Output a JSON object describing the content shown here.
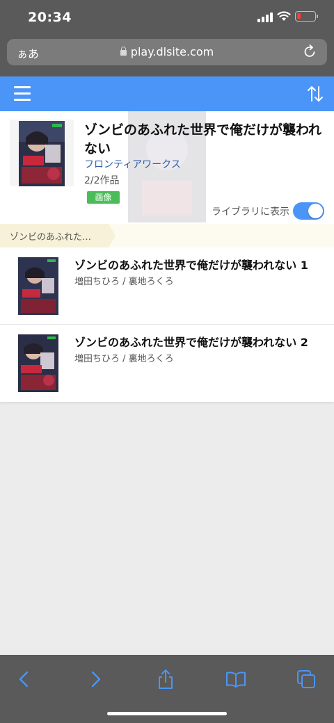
{
  "status": {
    "time": "20:34"
  },
  "browser": {
    "aa_label": "ぁあ",
    "url": "play.dlsite.com"
  },
  "series": {
    "title": "ゾンビのあふれた世界で俺だけが襲われない",
    "publisher": "フロンティアワークス",
    "count": "2/2作品",
    "badge": "画像",
    "library_label": "ライブラリに表示",
    "library_on": true
  },
  "breadcrumb": {
    "label": "ゾンビのあふれた…"
  },
  "volumes": [
    {
      "title": "ゾンビのあふれた世界で俺だけが襲われない 1",
      "author": "増田ちひろ / 裏地ろくろ"
    },
    {
      "title": "ゾンビのあふれた世界で俺だけが襲われない 2",
      "author": "増田ちひろ / 裏地ろくろ"
    }
  ],
  "colors": {
    "accent": "#4a95f7",
    "badge": "#4cbc5a",
    "publisher_link": "#2a5ca8",
    "chrome": "#5a5a5a"
  },
  "icons": [
    "hamburger-icon",
    "sort-icon",
    "lock-icon",
    "reload-icon",
    "back-icon",
    "forward-icon",
    "share-icon",
    "bookmarks-icon",
    "tabs-icon"
  ]
}
